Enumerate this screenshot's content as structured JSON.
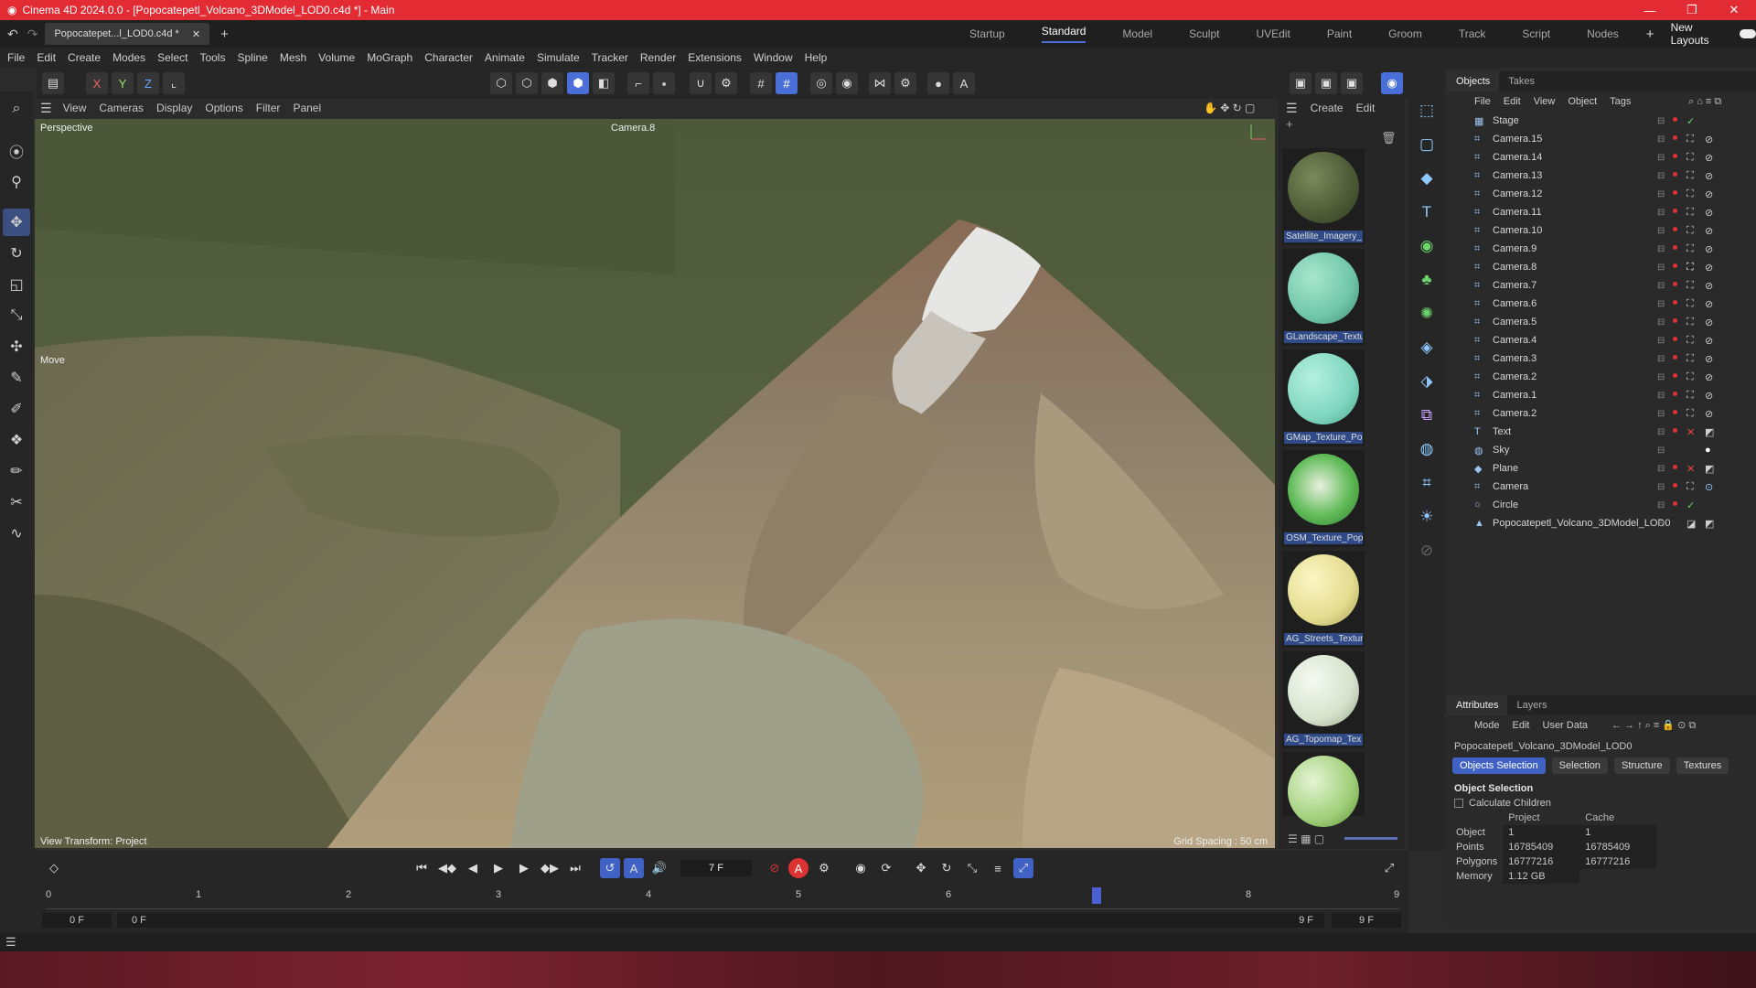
{
  "titlebar": {
    "title": "Cinema 4D 2024.0.0 - [Popocatepetl_Volcano_3DModel_LOD0.c4d *] - Main",
    "minimize": "—",
    "maximize": "❐",
    "close": "✕"
  },
  "tabs": {
    "doc_tab": "Popocatepetl_Volcano_3DModel_LOD0.c4d *",
    "short_tab": "Popocatepet...l_LOD0.c4d *"
  },
  "layouts": [
    "Startup",
    "Standard",
    "Model",
    "Sculpt",
    "UVEdit",
    "Paint",
    "Groom",
    "Track",
    "Script",
    "Nodes"
  ],
  "active_layout": "Standard",
  "new_layouts": "New Layouts",
  "menu": [
    "File",
    "Edit",
    "Create",
    "Modes",
    "Select",
    "Tools",
    "Spline",
    "Mesh",
    "Volume",
    "MoGraph",
    "Character",
    "Animate",
    "Simulate",
    "Tracker",
    "Render",
    "Extensions",
    "Window",
    "Help"
  ],
  "axis": {
    "x": "X",
    "y": "Y",
    "z": "Z"
  },
  "viewport": {
    "menu": [
      "View",
      "Cameras",
      "Display",
      "Options",
      "Filter",
      "Panel"
    ],
    "projection": "Perspective",
    "camera": "Camera.8",
    "tool": "Move",
    "view_transform": "View Transform: Project",
    "grid_spacing": "Grid Spacing : 50 cm"
  },
  "materials": {
    "menu": [
      "Create",
      "Edit"
    ],
    "items": [
      {
        "name": "Satellite_Imagery_",
        "color": "#4b5a35"
      },
      {
        "name": "GLandscape_Textu",
        "color": "#6fc6a8"
      },
      {
        "name": "GMap_Texture_Po",
        "color": "#7fd6be"
      },
      {
        "name": "OSM_Texture_Pop",
        "color": "#5fbb57"
      },
      {
        "name": "AG_Streets_Textur",
        "color": "#e4dc8f"
      },
      {
        "name": "AG_Topomap_Tex",
        "color": "#d6e2cc"
      },
      {
        "name": "",
        "color": "#9fcf78"
      }
    ]
  },
  "objects": {
    "tabs": [
      "Objects",
      "Takes"
    ],
    "menu": [
      "File",
      "Edit",
      "View",
      "Object",
      "Tags"
    ],
    "items": [
      {
        "name": "Stage",
        "icon": "▦"
      },
      {
        "name": "Camera.15",
        "icon": "⌗"
      },
      {
        "name": "Camera.14",
        "icon": "⌗"
      },
      {
        "name": "Camera.13",
        "icon": "⌗"
      },
      {
        "name": "Camera.12",
        "icon": "⌗"
      },
      {
        "name": "Camera.11",
        "icon": "⌗"
      },
      {
        "name": "Camera.10",
        "icon": "⌗"
      },
      {
        "name": "Camera.9",
        "icon": "⌗"
      },
      {
        "name": "Camera.8",
        "icon": "⌗"
      },
      {
        "name": "Camera.7",
        "icon": "⌗"
      },
      {
        "name": "Camera.6",
        "icon": "⌗"
      },
      {
        "name": "Camera.5",
        "icon": "⌗"
      },
      {
        "name": "Camera.4",
        "icon": "⌗"
      },
      {
        "name": "Camera.3",
        "icon": "⌗"
      },
      {
        "name": "Camera.2",
        "icon": "⌗"
      },
      {
        "name": "Camera.1",
        "icon": "⌗"
      },
      {
        "name": "Camera.2",
        "icon": "⌗"
      },
      {
        "name": "Text",
        "icon": "T"
      },
      {
        "name": "Sky",
        "icon": "◍"
      },
      {
        "name": "Plane",
        "icon": "◆"
      },
      {
        "name": "Camera",
        "icon": "⌗"
      },
      {
        "name": "Circle",
        "icon": "○"
      },
      {
        "name": "Popocatepetl_Volcano_3DModel_LOD0",
        "icon": "▲"
      }
    ]
  },
  "attributes": {
    "tabs": [
      "Attributes",
      "Layers"
    ],
    "menu": [
      "Mode",
      "Edit",
      "User Data"
    ],
    "object_name": "Popocatepetl_Volcano_3DModel_LOD0",
    "chips": [
      "Objects Selection",
      "Selection",
      "Structure",
      "Textures"
    ],
    "section": "Object Selection",
    "checkbox": "Calculate Children",
    "col_project": "Project",
    "col_cache": "Cache",
    "rows": [
      {
        "label": "Object",
        "project": "1",
        "cache": "1"
      },
      {
        "label": "Points",
        "project": "16785409",
        "cache": "16785409"
      },
      {
        "label": "Polygons",
        "project": "16777216",
        "cache": "16777216"
      },
      {
        "label": "Memory",
        "project": "1.12 GB",
        "cache": ""
      }
    ]
  },
  "timeline": {
    "current_frame": "7 F",
    "start_field": "0 F",
    "min_field": "0 F",
    "max_field": "9 F",
    "end_field": "9 F",
    "ticks": [
      "0",
      "1",
      "2",
      "3",
      "4",
      "5",
      "6",
      "7",
      "8",
      "9"
    ]
  }
}
